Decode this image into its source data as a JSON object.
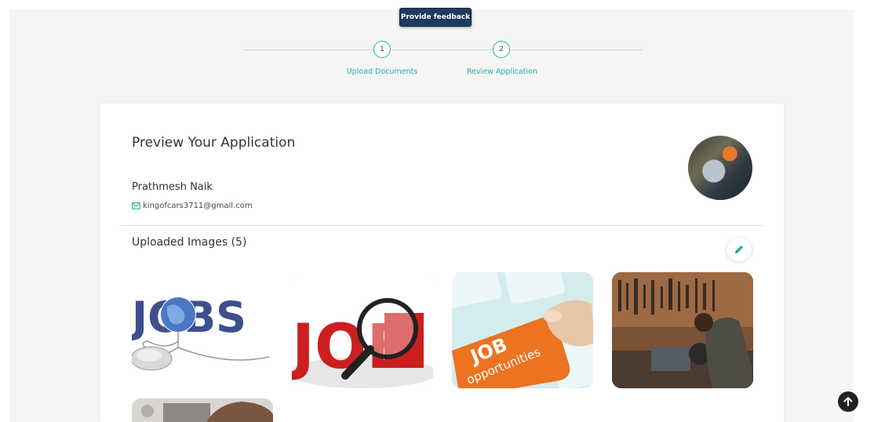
{
  "feedback": {
    "label": "Provide feedback"
  },
  "stepper": {
    "steps": [
      {
        "number": "1",
        "label": "Upload Documents"
      },
      {
        "number": "2",
        "label": "Review Application"
      }
    ]
  },
  "application": {
    "title": "Preview Your Application",
    "applicant_name": "Prathmesh Naik",
    "email": "kingofcars3711@gmail.com",
    "uploaded_images_title": "Uploaded Images (5)"
  },
  "images": [
    {
      "caption": "JOBS"
    },
    {
      "caption": "JOB"
    },
    {
      "caption_line1": "JOB",
      "caption_line2": "opportunities"
    },
    {
      "caption": ""
    },
    {
      "caption": ""
    }
  ],
  "colors": {
    "accent": "#20b3a0",
    "feedback_bg": "#1e3a5f",
    "page_bg": "#f5f5f5"
  },
  "icons": {
    "email": "mail-icon",
    "edit": "pencil-icon",
    "scroll_top": "arrow-up-icon"
  }
}
